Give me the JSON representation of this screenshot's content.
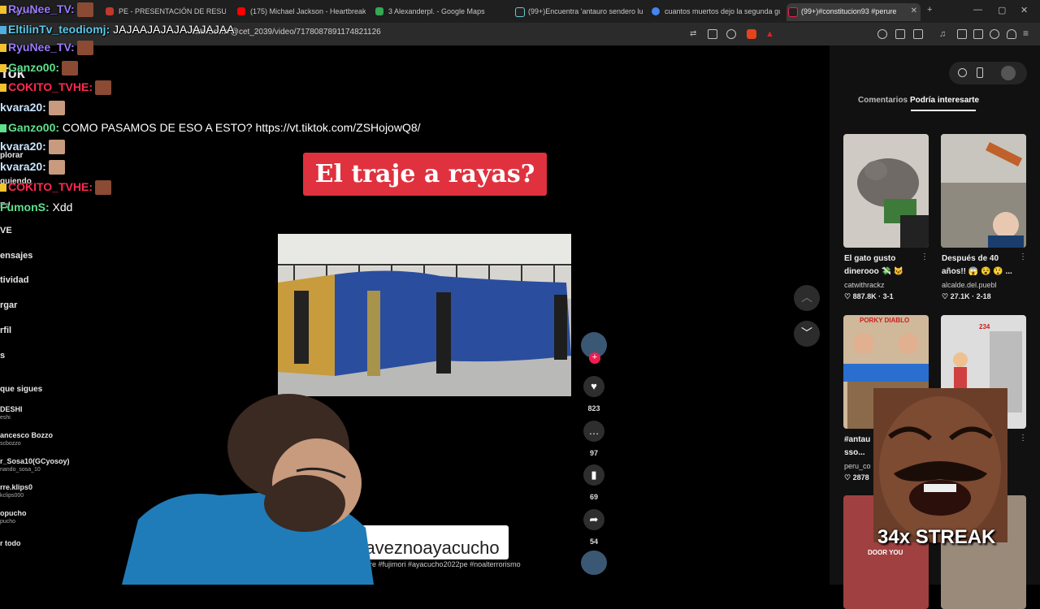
{
  "browser": {
    "tabs": [
      {
        "label": "PE - PRESENTACIÓN DE RESULTA"
      },
      {
        "label": "(175) Michael Jackson - Heartbreak"
      },
      {
        "label": "3 Alexanderpl. - Google Maps"
      },
      {
        "label": "(99+)Encuentra 'antauro sendero lu"
      },
      {
        "label": "cuantos muertos dejo la segunda gu"
      },
      {
        "label": "(99+)#constitucion93 #perure"
      }
    ],
    "url": "tiktok.com/@cet_2039/video/7178087891174821126"
  },
  "left_nav": {
    "logo_fragment": "Tok",
    "items": [
      "plorar",
      "guiendo",
      "Ed",
      "VE",
      "ensajes",
      "tividad",
      "rgar",
      "rfil",
      "s"
    ],
    "following_heading": "que sigues",
    "following": [
      {
        "name": "DESHI",
        "handle": "eshi"
      },
      {
        "name": "ancesco Bozzo",
        "handle": "scbozzo"
      },
      {
        "name": "r_Sosa10(GCyosoy)",
        "handle": "nando_sosa_10"
      },
      {
        "name": "rre.klips0",
        "handle": "kclips000"
      },
      {
        "name": "opucho",
        "handle": "pucho"
      }
    ],
    "see_all": "r todo"
  },
  "chat": [
    {
      "user": "RyuNee_TV:",
      "color": "#9b7bff",
      "msg": ""
    },
    {
      "user": "EltilinTv_teodiomj:",
      "color": "#5bc8e8",
      "msg": "JAJAAJAJAJAJAJAJAA"
    },
    {
      "user": "RyuNee_TV:",
      "color": "#9b7bff",
      "msg": ""
    },
    {
      "user": "Ganzo00:",
      "color": "#5ee08c",
      "msg": ""
    },
    {
      "user": "COKITO_TVHE:",
      "color": "#ff2a4f",
      "msg": ""
    },
    {
      "user": "kvara20:",
      "color": "#c9e4ff",
      "msg": ""
    },
    {
      "user": "Ganzo00:",
      "color": "#5ee08c",
      "msg": "COMO PASAMOS DE ESO A ESTO? https://vt.tiktok.com/ZSHojowQ8/"
    },
    {
      "user": "kvara20:",
      "color": "#c9e4ff",
      "msg": ""
    },
    {
      "user": "kvara20:",
      "color": "#c9e4ff",
      "msg": ""
    },
    {
      "user": "COKITO_TVHE:",
      "color": "#ff2a4f",
      "msg": ""
    },
    {
      "user": "FumonS:",
      "color": "#5ee08c",
      "msg": "Xdd"
    }
  ],
  "video": {
    "title_card": "El traje a rayas?",
    "likes": "823",
    "comments": "97",
    "saves": "69",
    "shares": "54",
    "hashtag_overlay": "traveznoayacucho",
    "caption": "#perure #fujimori #ayacucho2022pe #noalterrorismo"
  },
  "right_panel": {
    "tabs": [
      "Comentarios",
      "Podría interesarte"
    ],
    "cards": [
      {
        "title": "El gato gusto dinerooo 💸 🐱",
        "user": "catwithrackz",
        "stats": "887.8K · 3-1"
      },
      {
        "title": "Después de 40 años!! 😱 😵 😲 ...",
        "user": "alcalde.del.puebl",
        "stats": "27.1K · 2-18"
      },
      {
        "title": "#antau sso...",
        "user": "peru_co",
        "stats": "2878",
        "thumb_text": "PORKY DIABLO"
      },
      {
        "title": "",
        "user": "",
        "stats": "",
        "thumb_text": "234"
      },
      {
        "title": "",
        "user": "",
        "stats": "",
        "thumb_text": "DOOR YOU"
      }
    ]
  },
  "overlay": {
    "streak": "34x STREAK"
  }
}
